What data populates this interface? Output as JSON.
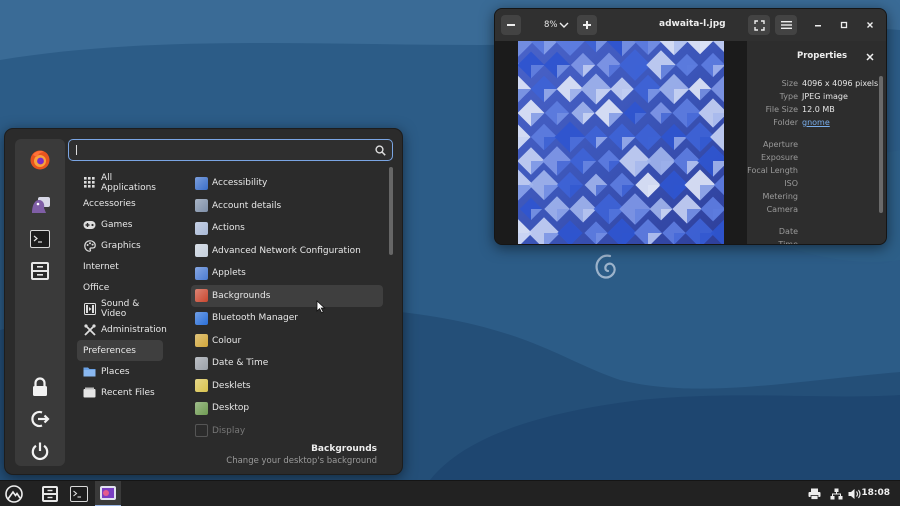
{
  "menu": {
    "search": {
      "value": "",
      "placeholder": ""
    },
    "favorites": [
      {
        "name": "firefox-icon"
      },
      {
        "name": "pidgin-icon"
      },
      {
        "name": "terminal-icon"
      },
      {
        "name": "file-cabinet-icon"
      }
    ],
    "session_buttons": [
      {
        "name": "lock-icon"
      },
      {
        "name": "logout-icon"
      },
      {
        "name": "power-icon"
      }
    ],
    "categories": [
      {
        "label": "All Applications",
        "icon": "grid-icon"
      },
      {
        "label": "Accessories",
        "icon": ""
      },
      {
        "label": "Games",
        "icon": "gamepad-icon"
      },
      {
        "label": "Graphics",
        "icon": "palette-icon"
      },
      {
        "label": "Internet",
        "icon": ""
      },
      {
        "label": "Office",
        "icon": ""
      },
      {
        "label": "Sound & Video",
        "icon": "media-icon"
      },
      {
        "label": "Administration",
        "icon": "tools-icon"
      },
      {
        "label": "Preferences",
        "icon": ""
      },
      {
        "label": "Places",
        "icon": "folder-icon"
      },
      {
        "label": "Recent Files",
        "icon": "recent-icon"
      }
    ],
    "selected_category": "Preferences",
    "apps": [
      {
        "label": "Accessibility",
        "color": "#3a6ec9"
      },
      {
        "label": "Account details",
        "color": "#7e8fa8"
      },
      {
        "label": "Actions",
        "color": "#a9b9d6"
      },
      {
        "label": "Advanced Network Configuration",
        "color": "#c5cfdc"
      },
      {
        "label": "Applets",
        "color": "#4b7bd2"
      },
      {
        "label": "Backgrounds",
        "color": "#c9472f"
      },
      {
        "label": "Bluetooth Manager",
        "color": "#2a6fd8"
      },
      {
        "label": "Colour",
        "color": "#d1a63a"
      },
      {
        "label": "Date & Time",
        "color": "#9aa0a8"
      },
      {
        "label": "Desklets",
        "color": "#d8c24e"
      },
      {
        "label": "Desktop",
        "color": "#6f9b52"
      },
      {
        "label": "Display",
        "color": "#555555"
      }
    ],
    "hovered_app": "Backgrounds",
    "description": {
      "title": "Backgrounds",
      "text": "Change your desktop's background"
    }
  },
  "viewer": {
    "zoom": "8%",
    "title": "adwaita-l.jpg",
    "properties_title": "Properties",
    "properties": [
      {
        "key": "Size",
        "value": "4096 x 4096 pixels"
      },
      {
        "key": "Type",
        "value": "JPEG image"
      },
      {
        "key": "File Size",
        "value": "12.0 MB"
      },
      {
        "key": "Folder",
        "value": "gnome",
        "link": true
      },
      {
        "key": "Aperture",
        "value": ""
      },
      {
        "key": "Exposure",
        "value": ""
      },
      {
        "key": "Focal Length",
        "value": ""
      },
      {
        "key": "ISO",
        "value": ""
      },
      {
        "key": "Metering",
        "value": ""
      },
      {
        "key": "Camera",
        "value": ""
      },
      {
        "key": "Date",
        "value": ""
      },
      {
        "key": "Time",
        "value": ""
      }
    ]
  },
  "taskbar": {
    "clock": "18:08"
  },
  "colors": {
    "accent": "#78aeed",
    "desktop_dark": "#1f4a73",
    "desktop_light": "#3a6d9a"
  }
}
